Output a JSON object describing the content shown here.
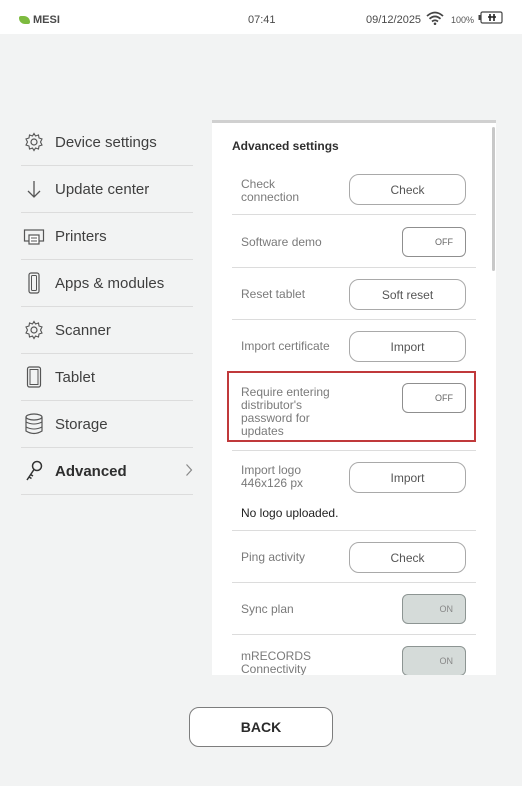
{
  "status_bar": {
    "brand": "MESI",
    "time": "07:41",
    "date": "09/12/2025",
    "battery": "100%"
  },
  "menu": {
    "items": [
      {
        "label": "Device settings",
        "icon": "gear-icon"
      },
      {
        "label": "Update center",
        "icon": "arrow-down-icon"
      },
      {
        "label": "Printers",
        "icon": "printer-icon"
      },
      {
        "label": "Apps & modules",
        "icon": "apps-icon"
      },
      {
        "label": "Scanner",
        "icon": "gear-icon"
      },
      {
        "label": "Tablet",
        "icon": "tablet-icon"
      },
      {
        "label": "Storage",
        "icon": "storage-icon"
      },
      {
        "label": "Advanced",
        "icon": "key-icon",
        "active": true
      }
    ]
  },
  "panel": {
    "title": "Advanced settings",
    "rows": {
      "check_connection": {
        "label": "Check connection",
        "button": "Check"
      },
      "software_demo": {
        "label": "Software demo",
        "toggle": "OFF"
      },
      "reset_tablet": {
        "label": "Reset tablet",
        "button": "Soft reset"
      },
      "import_certificate": {
        "label": "Import certificate",
        "button": "Import"
      },
      "require_password": {
        "label": "Require entering distributor's password for updates",
        "toggle": "OFF"
      },
      "import_logo": {
        "label": "Import logo 446x126 px",
        "button": "Import",
        "note": "No logo uploaded."
      },
      "ping_activity": {
        "label": "Ping activity",
        "button": "Check"
      },
      "sync_plan": {
        "label": "Sync plan",
        "toggle": "ON"
      },
      "mrecords": {
        "label": "mRECORDS Connectivity",
        "toggle": "ON"
      }
    }
  },
  "back_button": "BACK",
  "colors": {
    "background": "#f2f3f3",
    "highlight": "#c0393b",
    "brand": "#7dbb3f",
    "toggle_on": "#d5dbd9"
  }
}
